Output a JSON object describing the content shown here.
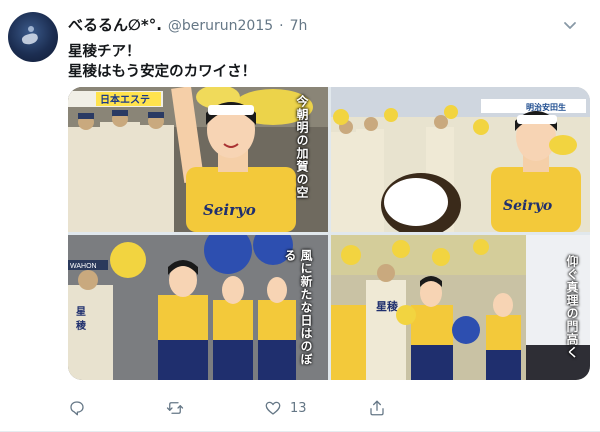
{
  "tweet": {
    "display_name": "べるるん∅*°.",
    "handle": "@berurun2015",
    "separator": "·",
    "time": "7h",
    "text_line1": "星稜チア！",
    "text_line2": "星稜はもう安定のカワイさ！",
    "menu_icon": "chevron-down-icon"
  },
  "media": {
    "images": [
      {
        "caption": "今朝明の加賀の空",
        "banner": "日本エステ",
        "jersey": "Seiryo"
      },
      {
        "banner": "明治安田生",
        "jersey": "Seiryo"
      },
      {
        "caption": "風に新たな日はのぼる",
        "banner": "WAHON"
      },
      {
        "caption": "仰ぐ真理の門高く",
        "banner": "星稜"
      }
    ]
  },
  "actions": {
    "reply_icon": "reply-icon",
    "retweet_icon": "retweet-icon",
    "like_icon": "heart-icon",
    "like_count": "13",
    "share_icon": "share-icon"
  },
  "colors": {
    "text_primary": "#14171a",
    "text_secondary": "#657786",
    "cheer_yellow": "#f3d23a",
    "cheer_navy": "#1f2f6e"
  }
}
